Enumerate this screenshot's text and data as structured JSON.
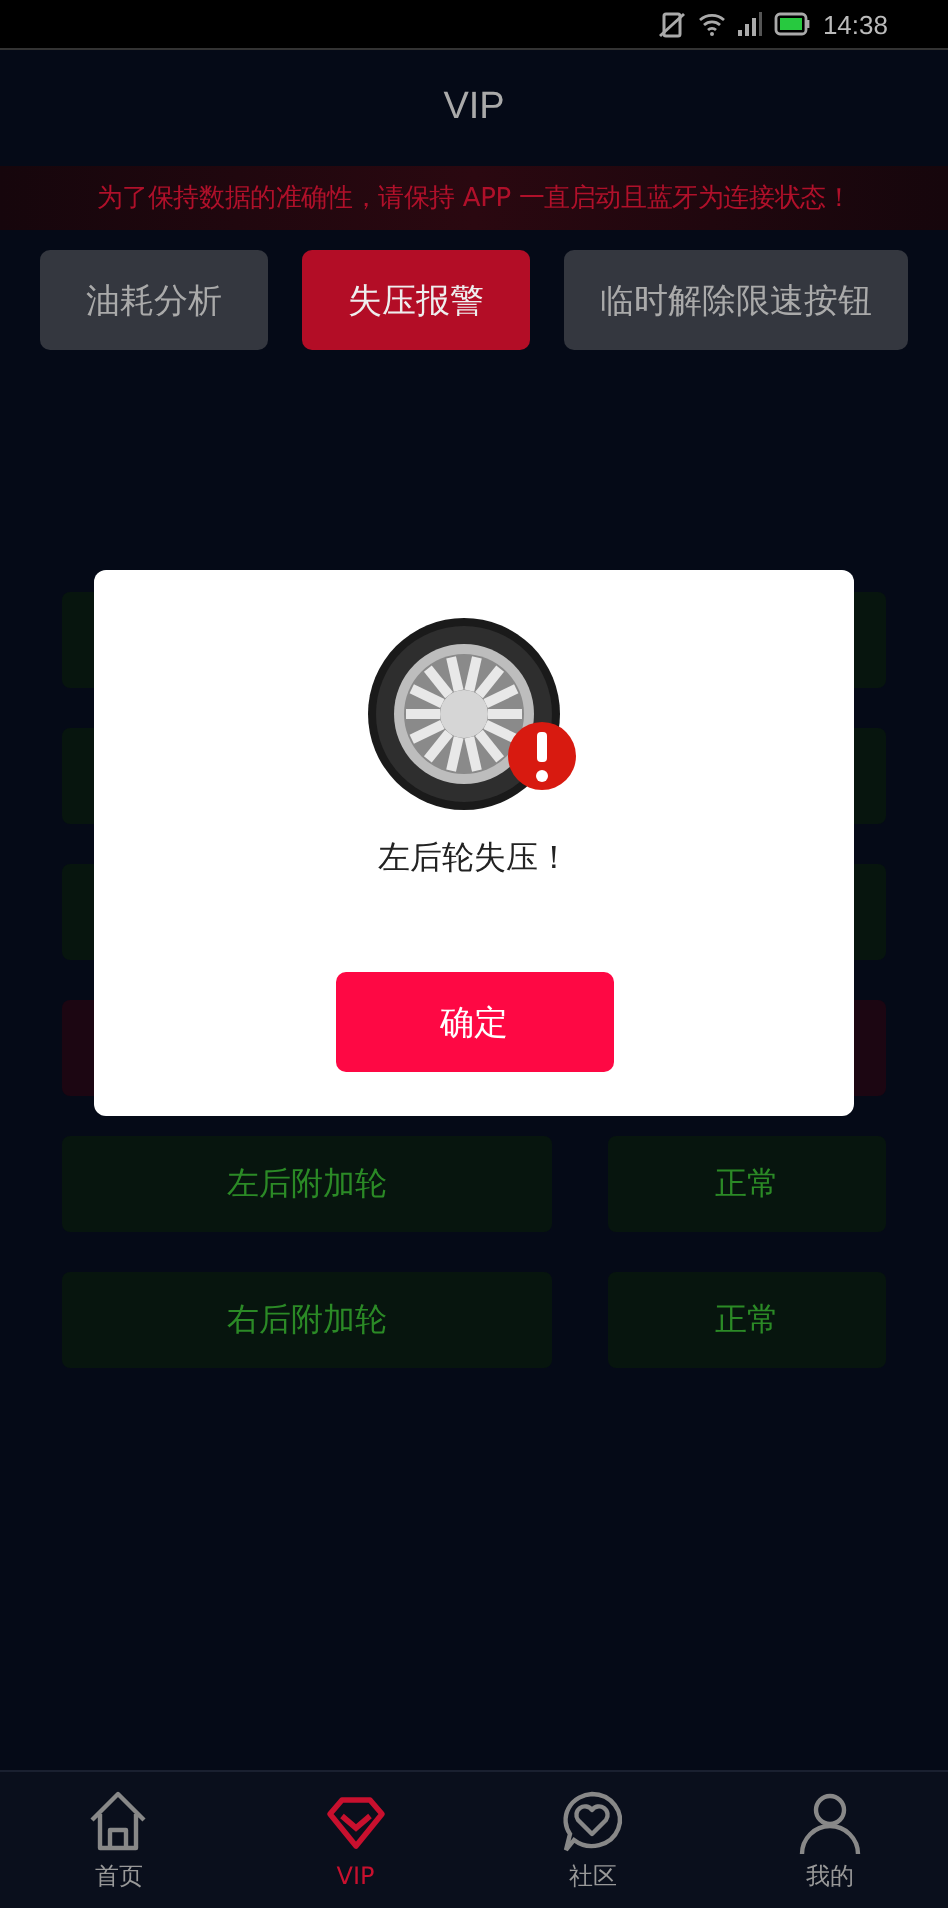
{
  "status_bar": {
    "time": "14:38"
  },
  "header": {
    "title": "VIP"
  },
  "notice": "为了保持数据的准确性，请保持 APP 一直启动且蓝牙为连接状态！",
  "tabs": [
    {
      "label": "油耗分析",
      "selected": false
    },
    {
      "label": "失压报警",
      "selected": true
    },
    {
      "label": "临时解除限速按钮",
      "selected": false
    }
  ],
  "rows": [
    {
      "alarm": false
    },
    {
      "alarm": false
    },
    {
      "alarm": false
    },
    {
      "alarm": true
    },
    {
      "alarm": false,
      "label": "左后附加轮",
      "status": "正常"
    },
    {
      "alarm": false,
      "label": "右后附加轮",
      "status": "正常"
    }
  ],
  "dialog": {
    "message": "左后轮失压！",
    "button": "确定"
  },
  "nav": [
    {
      "label": "首页",
      "selected": false
    },
    {
      "label": "VIP",
      "selected": true
    },
    {
      "label": "社区",
      "selected": false
    },
    {
      "label": "我的",
      "selected": false
    }
  ]
}
